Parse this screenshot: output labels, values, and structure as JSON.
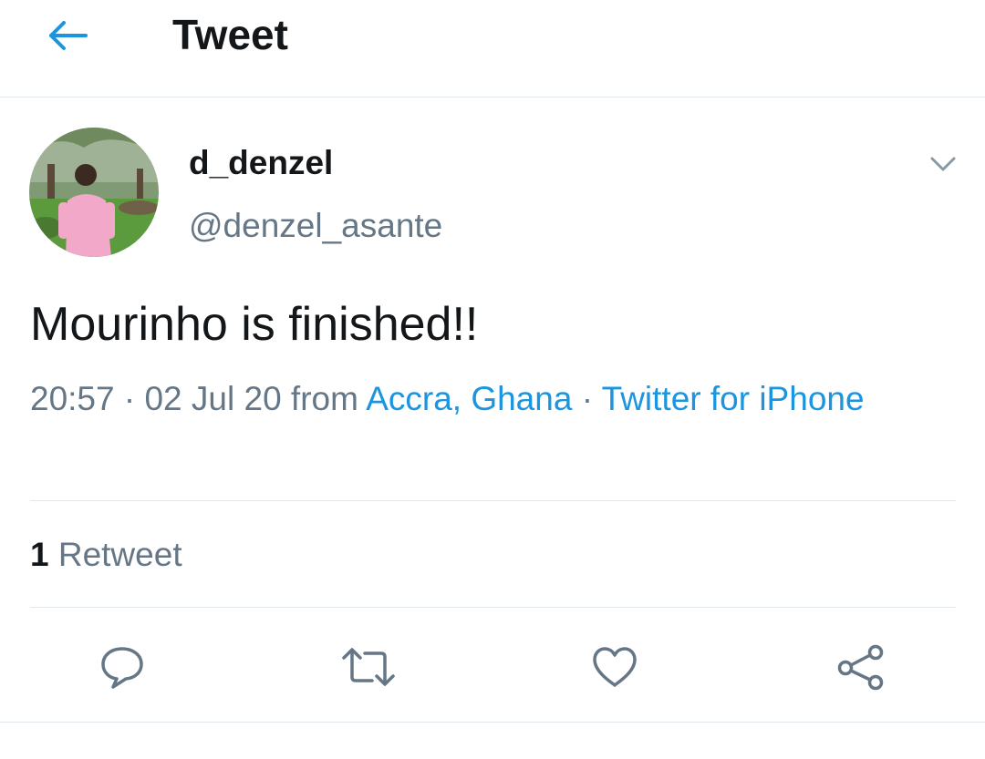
{
  "header": {
    "title": "Tweet",
    "back_icon": "arrow-left-icon"
  },
  "tweet": {
    "author": {
      "display_name": "d_denzel",
      "handle": "@denzel_asante"
    },
    "menu_icon": "chevron-down-icon",
    "text": "Mourinho is finished!!",
    "meta": {
      "time": "20:57",
      "separator": " · ",
      "date": "02 Jul 20",
      "from": " from ",
      "location": "Accra, Ghana",
      "source": "Twitter for iPhone"
    },
    "stats": {
      "retweet_count": "1",
      "retweet_label": "Retweet"
    },
    "actions": [
      {
        "name": "reply",
        "icon": "reply-icon"
      },
      {
        "name": "retweet",
        "icon": "retweet-icon"
      },
      {
        "name": "like",
        "icon": "heart-icon"
      },
      {
        "name": "share",
        "icon": "share-icon"
      }
    ]
  },
  "colors": {
    "accent": "#1b95e0",
    "text_primary": "#14171a",
    "text_secondary": "#657786",
    "icon_gray": "#657786",
    "divider": "#e1e8ed"
  }
}
